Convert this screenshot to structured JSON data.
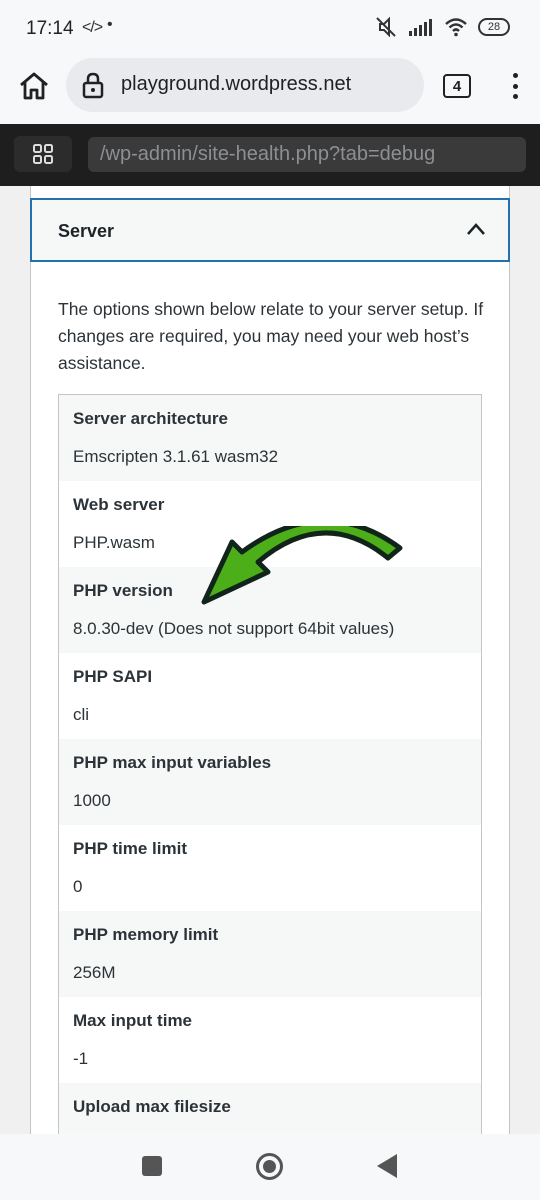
{
  "status_bar": {
    "time": "17:14",
    "code_icon": "</>",
    "dot": "•",
    "battery": "28",
    "icons": [
      "mute-icon",
      "signal-icon",
      "wifi-icon",
      "battery-icon"
    ]
  },
  "browser": {
    "url": "playground.wordpress.net",
    "tab_count": "4"
  },
  "playground": {
    "path": "/wp-admin/site-health.php?tab=debug"
  },
  "section": {
    "title": "Server",
    "description": "The options shown below relate to your server setup. If changes are required, you may need your web host’s assistance."
  },
  "rows": [
    {
      "label": "Server architecture",
      "value": "Emscripten 3.1.61 wasm32"
    },
    {
      "label": "Web server",
      "value": "PHP.wasm"
    },
    {
      "label": "PHP version",
      "value": "8.0.30-dev (Does not support 64bit values)"
    },
    {
      "label": "PHP SAPI",
      "value": "cli"
    },
    {
      "label": "PHP max input variables",
      "value": "1000"
    },
    {
      "label": "PHP time limit",
      "value": "0"
    },
    {
      "label": "PHP memory limit",
      "value": "256M"
    },
    {
      "label": "Max input time",
      "value": "-1"
    },
    {
      "label": "Upload max filesize",
      "value": ""
    }
  ],
  "colors": {
    "accent": "#2271b1",
    "arrow": "#4caf1a",
    "toolbar": "#1e1e1e"
  }
}
